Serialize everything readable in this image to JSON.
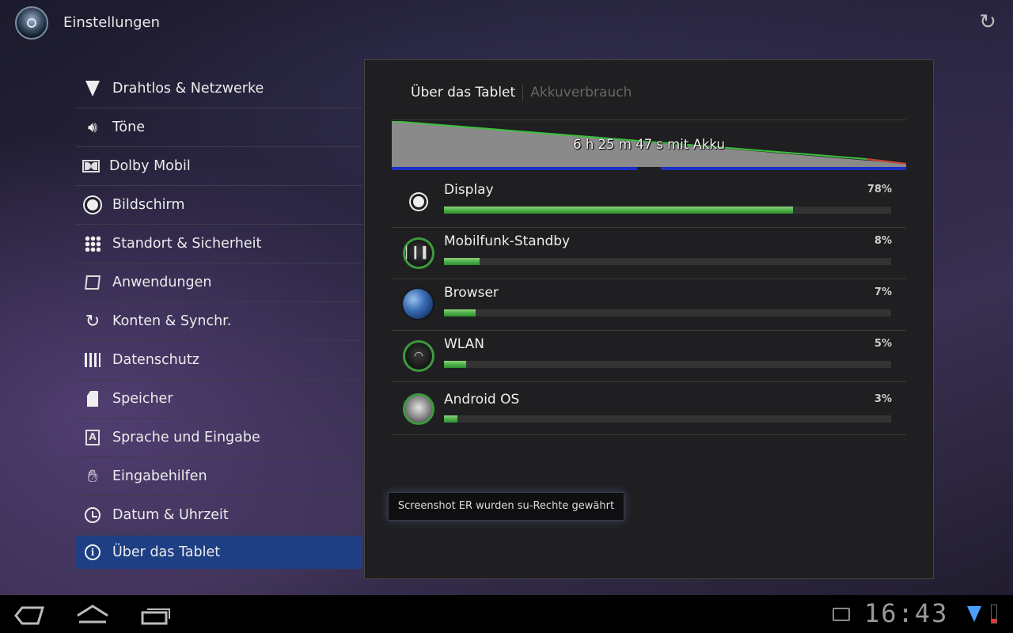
{
  "app": {
    "title": "Einstellungen",
    "icon": "settings-app-icon",
    "refresh_icon": "sync-icon"
  },
  "sidebar": {
    "items": [
      {
        "label": "Drahtlos & Netzwerke",
        "icon": "wireless-icon"
      },
      {
        "label": "Töne",
        "icon": "speaker-icon"
      },
      {
        "label": "Dolby Mobil",
        "icon": "dolby-icon"
      },
      {
        "label": "Bildschirm",
        "icon": "brightness-icon"
      },
      {
        "label": "Standort & Sicherheit",
        "icon": "location-security-icon"
      },
      {
        "label": "Anwendungen",
        "icon": "applications-icon"
      },
      {
        "label": "Konten & Synchr.",
        "icon": "sync-icon"
      },
      {
        "label": "Datenschutz",
        "icon": "privacy-icon"
      },
      {
        "label": "Speicher",
        "icon": "sd-card-icon"
      },
      {
        "label": "Sprache und Eingabe",
        "icon": "language-icon"
      },
      {
        "label": "Eingabehilfen",
        "icon": "accessibility-hand-icon"
      },
      {
        "label": "Datum & Uhrzeit",
        "icon": "clock-icon"
      },
      {
        "label": "Über das Tablet",
        "icon": "info-icon",
        "active": true
      }
    ]
  },
  "panel": {
    "breadcrumb": {
      "current": "Über das Tablet",
      "next": "Akkuverbrauch"
    },
    "battery_graph": {
      "label": "6 h 25 m 47 s mit Akku"
    },
    "usage": [
      {
        "label": "Display",
        "percent": "78%",
        "fraction": 0.78,
        "icon": "display-brightness-icon"
      },
      {
        "label": "Mobilfunk-Standby",
        "percent": "8%",
        "fraction": 0.08,
        "icon": "cell-standby-icon"
      },
      {
        "label": "Browser",
        "percent": "7%",
        "fraction": 0.07,
        "icon": "browser-globe-icon"
      },
      {
        "label": "WLAN",
        "percent": "5%",
        "fraction": 0.05,
        "icon": "wifi-icon"
      },
      {
        "label": "Android OS",
        "percent": "3%",
        "fraction": 0.03,
        "icon": "android-os-icon"
      }
    ]
  },
  "toast": {
    "text": "Screenshot ER wurden su-Rechte gewährt"
  },
  "navbar": {
    "back_icon": "back-icon",
    "home_icon": "home-icon",
    "recent_icon": "recent-apps-icon"
  },
  "status": {
    "time": "16:43",
    "accent": "#4aa0ff",
    "battery_color": "#e33333"
  }
}
